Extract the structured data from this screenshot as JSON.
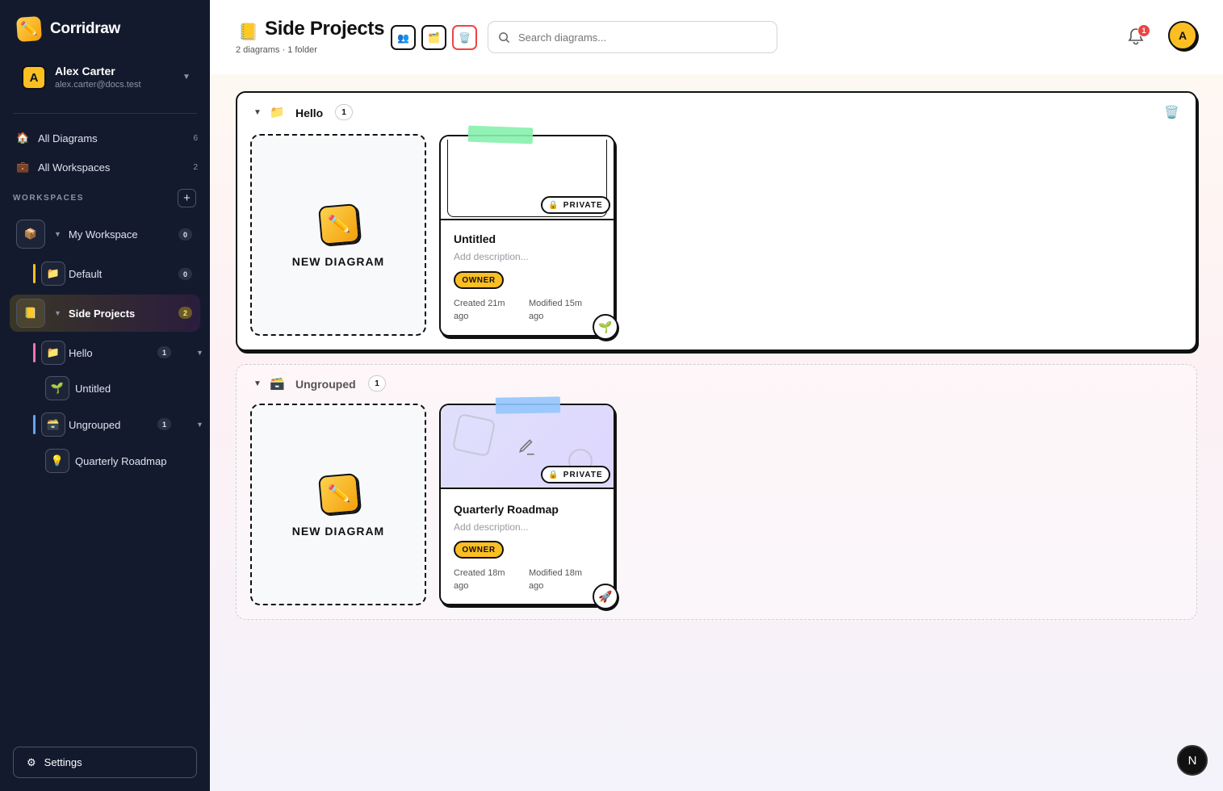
{
  "app": {
    "name": "Corridraw",
    "logo_icon": "✏️"
  },
  "user": {
    "initial": "A",
    "name": "Alex Carter",
    "email": "alex.carter@docs.test"
  },
  "nav": [
    {
      "label": "All Diagrams",
      "icon": "🏠",
      "count": "6"
    },
    {
      "label": "All Workspaces",
      "icon": "💼",
      "count": "2"
    }
  ],
  "workspaces": {
    "heading": "WORKSPACES",
    "add_label": "+",
    "my_workspace": {
      "label": "My Workspace",
      "count": "0"
    },
    "default": {
      "label": "Default",
      "count": "0"
    },
    "side_projects": {
      "label": "Side Projects",
      "count": "2"
    },
    "hello": {
      "label": "Hello",
      "count": "1"
    },
    "untitled": {
      "label": "Untitled"
    },
    "ungrouped": {
      "label": "Ungrouped",
      "count": "1"
    },
    "roadmap": {
      "label": "Quarterly Roadmap"
    }
  },
  "settings": {
    "label": "Settings"
  },
  "page": {
    "title_icon": "📒",
    "title": "Side Projects",
    "subtitle": "2 diagrams · 1 folder"
  },
  "search": {
    "placeholder": "Search diagrams..."
  },
  "notifications": {
    "count": "1"
  },
  "top_avatar": {
    "initial": "A"
  },
  "folders": [
    {
      "name": "Hello",
      "icon": "📁",
      "count": "1",
      "new_label": "NEW DIAGRAM",
      "card": {
        "title": "Untitled",
        "desc": "Add description...",
        "badge": "PRIVATE",
        "role": "OWNER",
        "created": "Created 21m ago",
        "modified": "Modified 15m ago",
        "emoji": "🌱",
        "tape_color": "#86efac"
      }
    },
    {
      "name": "Ungrouped",
      "icon": "🗃️",
      "count": "1",
      "new_label": "NEW DIAGRAM",
      "card": {
        "title": "Quarterly Roadmap",
        "desc": "Add description...",
        "badge": "PRIVATE",
        "role": "OWNER",
        "created": "Created 18m ago",
        "modified": "Modified 18m ago",
        "emoji": "🚀",
        "tape_color": "#93c5fd"
      }
    }
  ],
  "colors": {
    "sidebar_bg": "#141a2e",
    "accent": "#fbbf24",
    "badge_red": "#ef4444"
  },
  "corner_button": {
    "label": "N"
  }
}
